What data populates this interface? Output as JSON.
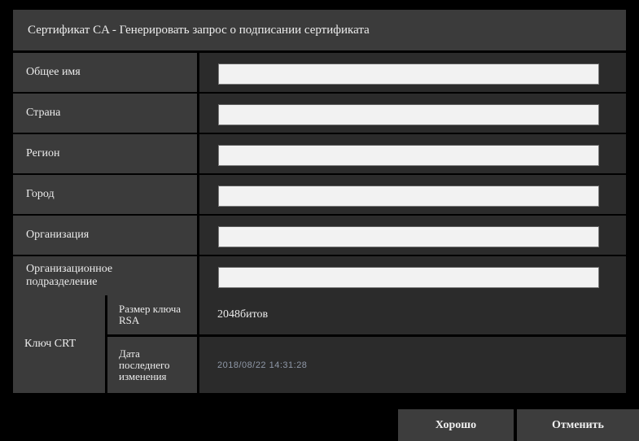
{
  "title": "Сертификат CA - Генерировать запрос о подписании сертификата",
  "fields": [
    {
      "label": "Общее имя",
      "value": ""
    },
    {
      "label": "Страна",
      "value": ""
    },
    {
      "label": "Регион",
      "value": ""
    },
    {
      "label": "Город",
      "value": ""
    },
    {
      "label": "Организация",
      "value": ""
    },
    {
      "label": "Организационное подразделение",
      "value": ""
    }
  ],
  "crt_key": {
    "label": "Ключ CRT",
    "rsa_size_label": "Размер ключа RSA",
    "rsa_size_value": "2048битов",
    "last_modified_label": "Дата последнего изменения",
    "last_modified_value": "2018/08/22 14:31:28"
  },
  "buttons": {
    "ok": "Хорошо",
    "cancel": "Отменить"
  },
  "colors": {
    "background": "#000000",
    "label_cell": "#3b3b3b",
    "value_cell": "#2b2b2b",
    "input": "#f2f2f2",
    "button": "#3d3d3d"
  }
}
